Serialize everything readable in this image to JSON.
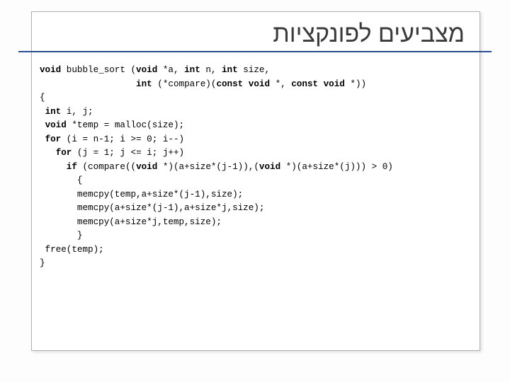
{
  "slide": {
    "title": "מצביעים לפונקציות",
    "code": {
      "l1a": "void",
      "l1b": " bubble_sort (",
      "l1c": "void",
      "l1d": " *a, ",
      "l1e": "int",
      "l1f": " n, ",
      "l1g": "int",
      "l1h": " size,",
      "l2a": "                  ",
      "l2b": "int",
      "l2c": " (*compare)(",
      "l2d": "const void",
      "l2e": " *, ",
      "l2f": "const void",
      "l2g": " *))",
      "l3": "{",
      "l4a": " ",
      "l4b": "int",
      "l4c": " i, j;",
      "l5a": " ",
      "l5b": "void",
      "l5c": " *temp = malloc(size);",
      "l6a": " ",
      "l6b": "for",
      "l6c": " (i = n-1; i >= 0; i--)",
      "l7a": "   ",
      "l7b": "for",
      "l7c": " (j = 1; j <= i; j++)",
      "l8a": "     ",
      "l8b": "if",
      "l8c": " (compare((",
      "l8d": "void",
      "l8e": " *)(a+size*(j-1)),(",
      "l8f": "void",
      "l8g": " *)(a+size*(j))) > 0)",
      "l9": "       {",
      "l10": "       memcpy(temp,a+size*(j-1),size);",
      "l11": "       memcpy(a+size*(j-1),a+size*j,size);",
      "l12": "       memcpy(a+size*j,temp,size);",
      "l13": "       }",
      "l14": " free(temp);",
      "l15": "}"
    }
  }
}
